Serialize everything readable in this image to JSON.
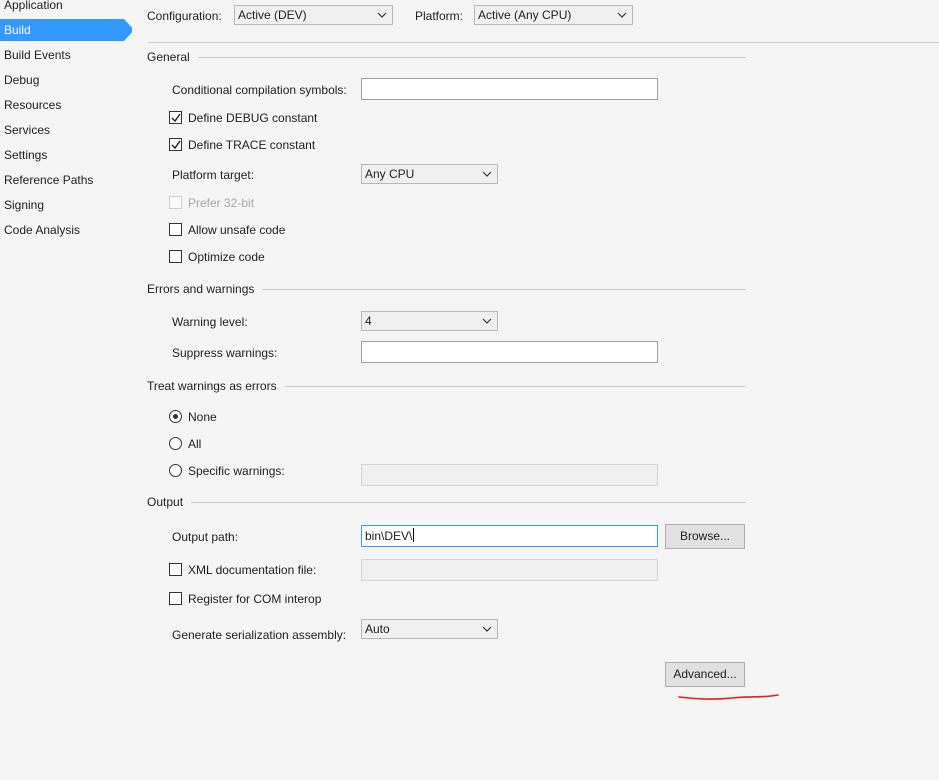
{
  "sidebar": {
    "items": [
      {
        "label": "Application"
      },
      {
        "label": "Build"
      },
      {
        "label": "Build Events"
      },
      {
        "label": "Debug"
      },
      {
        "label": "Resources"
      },
      {
        "label": "Services"
      },
      {
        "label": "Settings"
      },
      {
        "label": "Reference Paths"
      },
      {
        "label": "Signing"
      },
      {
        "label": "Code Analysis"
      }
    ],
    "active": "Build"
  },
  "toolbar": {
    "configuration_label": "Configuration:",
    "configuration_value": "Active (DEV)",
    "platform_label": "Platform:",
    "platform_value": "Active (Any CPU)"
  },
  "general": {
    "title": "General",
    "conditional_symbols_label": "Conditional compilation symbols:",
    "conditional_symbols_value": "",
    "define_debug_label": "Define DEBUG constant",
    "define_debug_checked": true,
    "define_trace_label": "Define TRACE constant",
    "define_trace_checked": true,
    "platform_target_label": "Platform target:",
    "platform_target_value": "Any CPU",
    "prefer32_label": "Prefer 32-bit",
    "prefer32_checked": false,
    "unsafe_label": "Allow unsafe code",
    "unsafe_checked": false,
    "optimize_label": "Optimize code",
    "optimize_checked": false
  },
  "errors": {
    "title": "Errors and warnings",
    "warning_level_label": "Warning level:",
    "warning_level_value": "4",
    "suppress_label": "Suppress warnings:",
    "suppress_value": ""
  },
  "treat": {
    "title": "Treat warnings as errors",
    "none_label": "None",
    "all_label": "All",
    "specific_label": "Specific warnings:",
    "selected": "None",
    "specific_value": ""
  },
  "output": {
    "title": "Output",
    "path_label": "Output path:",
    "path_value": "bin\\DEV\\",
    "browse_label": "Browse...",
    "xml_label": "XML documentation file:",
    "xml_checked": false,
    "xml_value": "",
    "com_label": "Register for COM interop",
    "com_checked": false,
    "serialization_label": "Generate serialization assembly:",
    "serialization_value": "Auto",
    "advanced_label": "Advanced..."
  },
  "colors": {
    "accent": "#3399ff",
    "annotation": "#e02020"
  }
}
